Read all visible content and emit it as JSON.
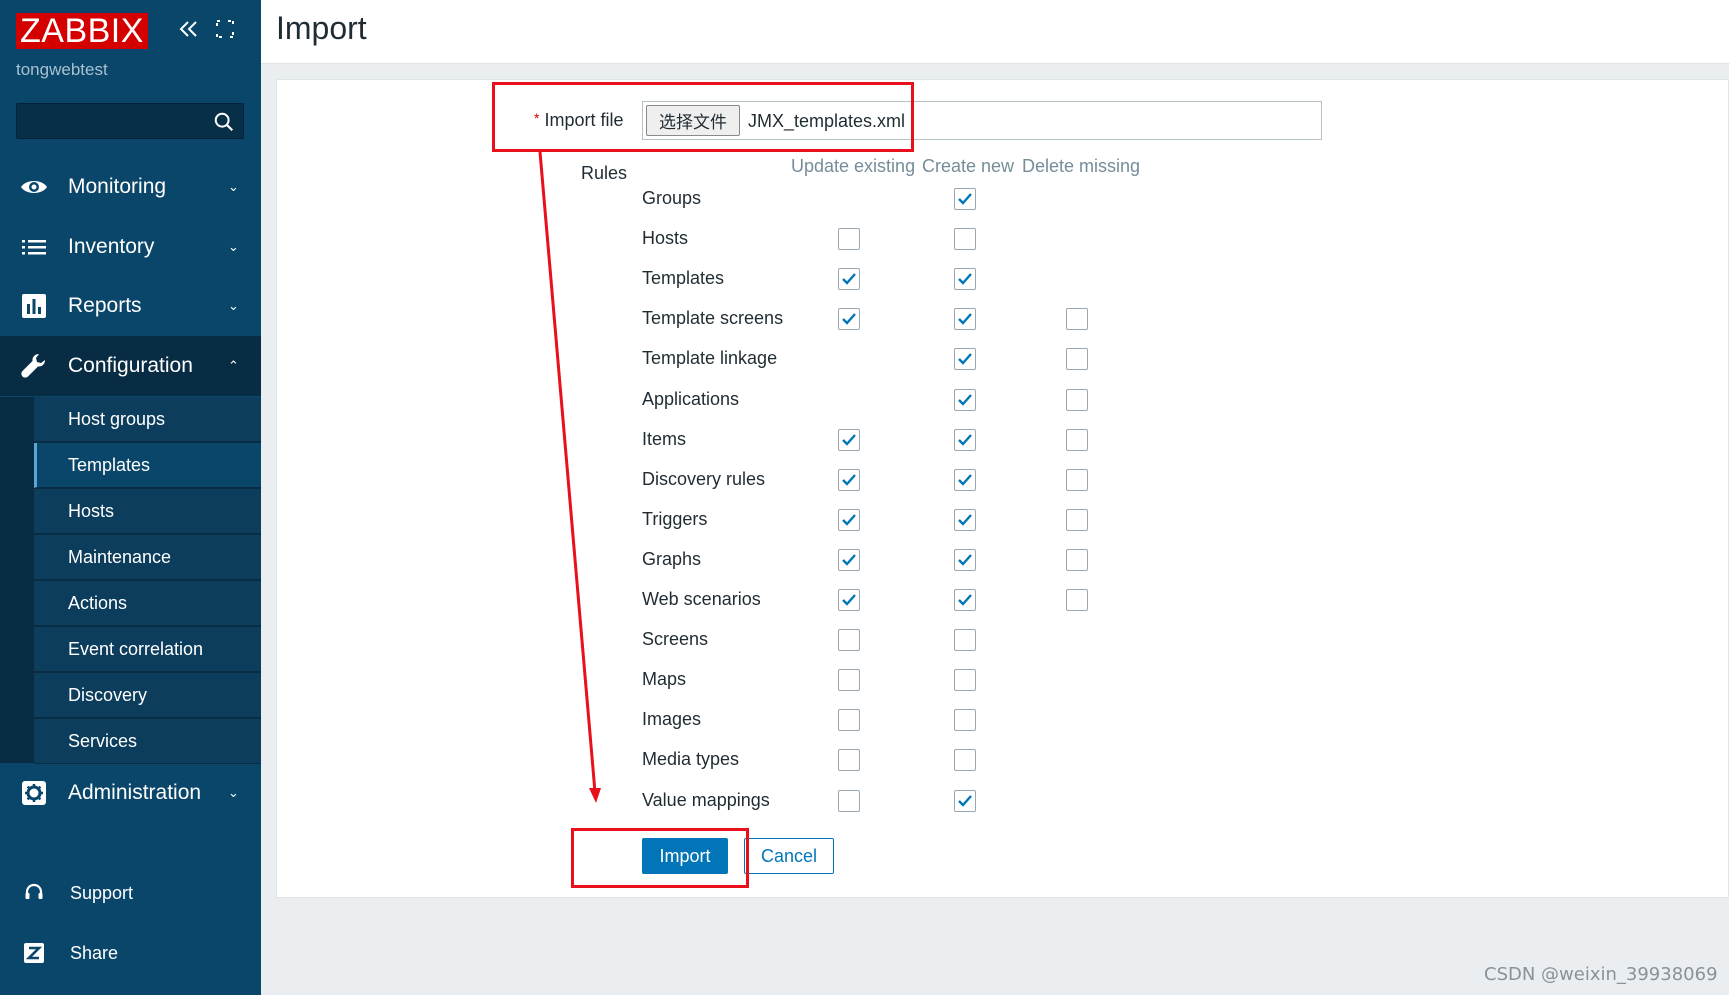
{
  "app": {
    "logo": "ZABBIX",
    "server_name": "tongwebtest",
    "search_value": ""
  },
  "colors": {
    "sidebar": "#0a466a",
    "sidebar_dark": "#072c43",
    "accent": "#0275b8",
    "logo_red": "#d40000",
    "annotation_red": "#e8101a"
  },
  "sidebar": {
    "menu": [
      {
        "label": "Monitoring",
        "icon": "eye-icon",
        "expanded": false
      },
      {
        "label": "Inventory",
        "icon": "list-icon",
        "expanded": false
      },
      {
        "label": "Reports",
        "icon": "bar-chart-icon",
        "expanded": false
      },
      {
        "label": "Configuration",
        "icon": "wrench-icon",
        "expanded": true
      },
      {
        "label": "Administration",
        "icon": "gear-icon",
        "expanded": false
      }
    ],
    "config_submenu": [
      {
        "label": "Host groups",
        "active": false
      },
      {
        "label": "Templates",
        "active": true
      },
      {
        "label": "Hosts",
        "active": false
      },
      {
        "label": "Maintenance",
        "active": false
      },
      {
        "label": "Actions",
        "active": false
      },
      {
        "label": "Event correlation",
        "active": false
      },
      {
        "label": "Discovery",
        "active": false
      },
      {
        "label": "Services",
        "active": false
      }
    ],
    "bottom": [
      {
        "label": "Support",
        "icon": "headset-icon"
      },
      {
        "label": "Share",
        "icon": "share-z-icon"
      }
    ]
  },
  "page": {
    "title": "Import"
  },
  "form": {
    "import_file_label": "Import file",
    "required_mark": "*",
    "file_button_label": "选择文件",
    "file_name": "JMX_templates.xml",
    "rules_label": "Rules",
    "columns": [
      "Update existing",
      "Create new",
      "Delete missing"
    ],
    "rules": [
      {
        "name": "Groups",
        "update": null,
        "create": true,
        "delete": null
      },
      {
        "name": "Hosts",
        "update": false,
        "create": false,
        "delete": null
      },
      {
        "name": "Templates",
        "update": true,
        "create": true,
        "delete": null
      },
      {
        "name": "Template screens",
        "update": true,
        "create": true,
        "delete": false
      },
      {
        "name": "Template linkage",
        "update": null,
        "create": true,
        "delete": false
      },
      {
        "name": "Applications",
        "update": null,
        "create": true,
        "delete": false
      },
      {
        "name": "Items",
        "update": true,
        "create": true,
        "delete": false
      },
      {
        "name": "Discovery rules",
        "update": true,
        "create": true,
        "delete": false
      },
      {
        "name": "Triggers",
        "update": true,
        "create": true,
        "delete": false
      },
      {
        "name": "Graphs",
        "update": true,
        "create": true,
        "delete": false
      },
      {
        "name": "Web scenarios",
        "update": true,
        "create": true,
        "delete": false
      },
      {
        "name": "Screens",
        "update": false,
        "create": false,
        "delete": null
      },
      {
        "name": "Maps",
        "update": false,
        "create": false,
        "delete": null
      },
      {
        "name": "Images",
        "update": false,
        "create": false,
        "delete": null
      },
      {
        "name": "Media types",
        "update": false,
        "create": false,
        "delete": null
      },
      {
        "name": "Value mappings",
        "update": false,
        "create": true,
        "delete": null
      }
    ],
    "import_button": "Import",
    "cancel_button": "Cancel"
  },
  "watermark": "CSDN @weixin_39938069"
}
